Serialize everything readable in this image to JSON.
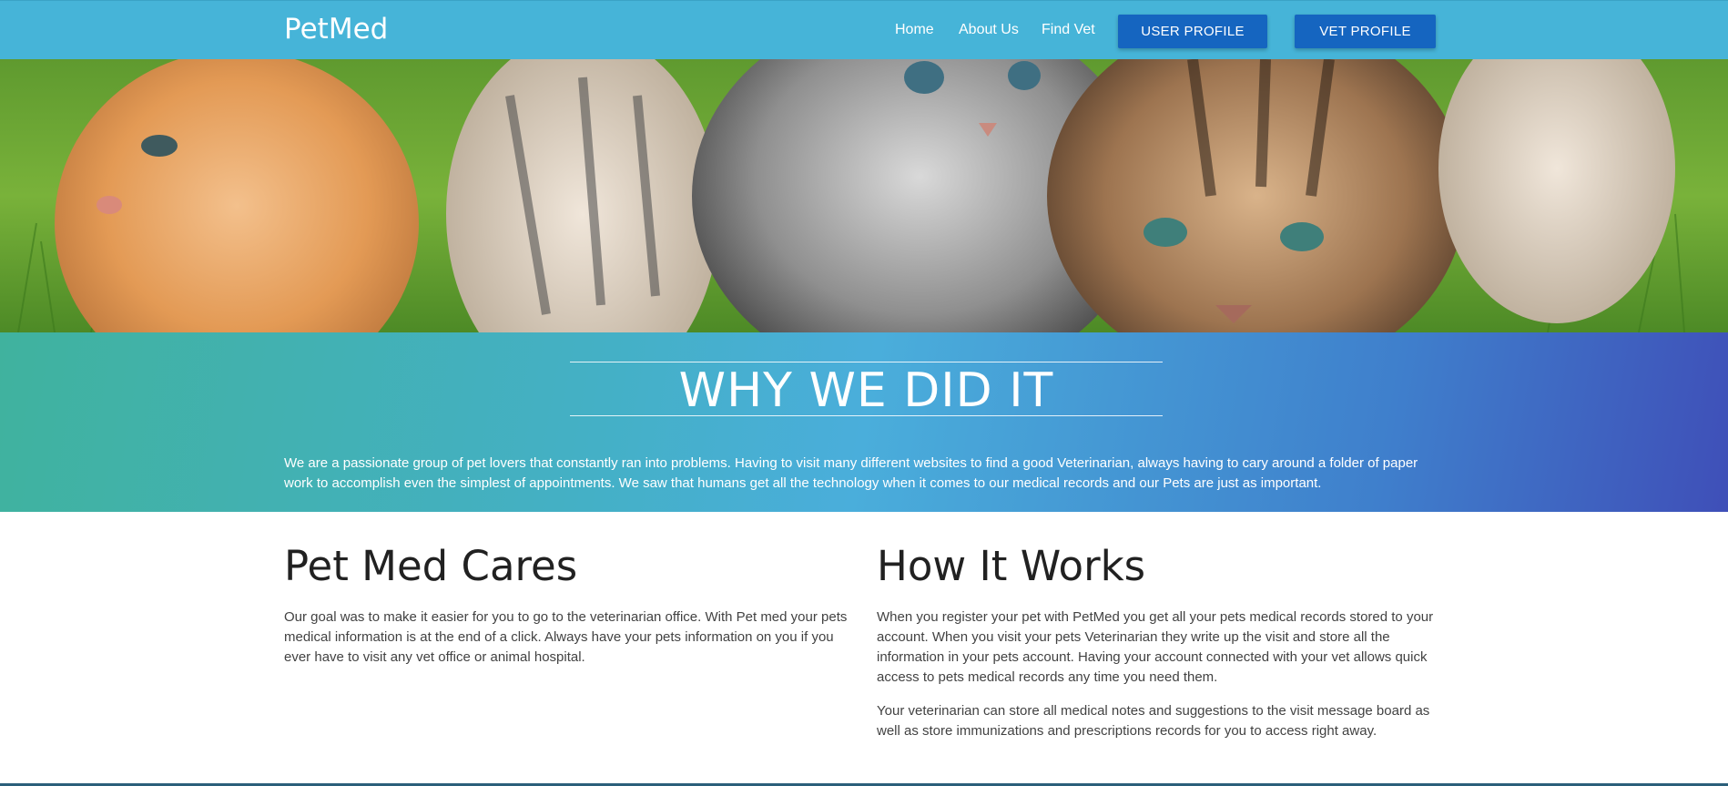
{
  "header": {
    "brand": "PetMed",
    "nav": [
      {
        "label": "Home"
      },
      {
        "label": "About Us"
      },
      {
        "label": "Find Vet"
      }
    ],
    "user_profile_label": "USER PROFILE",
    "vet_profile_label": "VET PROFILE"
  },
  "hero": {
    "image": "kittens-in-grass-photo"
  },
  "why": {
    "title": "WHY WE DID IT",
    "text": "We are a passionate group of pet lovers that constantly ran into problems. Having to visit many different websites to find a good Veterinarian, always having to cary around a folder of paper work to accomplish even the simplest of appointments. We saw that humans get all the technology when it comes to our medical records and our Pets are just as important."
  },
  "cares": {
    "title": "Pet Med Cares",
    "text": "Our goal was to make it easier for you to go to the veterinarian office. With Pet med your pets medical information is at the end of a click. Always have your pets information on you if you ever have to visit any vet office or animal hospital."
  },
  "how": {
    "title": "How It Works",
    "paragraphs": [
      "When you register your pet with PetMed you get all your pets medical records stored to your account. When you visit your pets Veterinarian they write up the visit and store all the information in your pets account. Having your account connected with your vet allows quick access to pets medical records any time you need them.",
      "Your veterinarian can store all medical notes and suggestions to the visit message board as well as store immunizations and prescriptions records for you to access right away."
    ]
  },
  "colors": {
    "navbar": "#46b4d8",
    "button": "#1565c0",
    "gradient_start": "#40b29e",
    "gradient_end": "#3f4fb8"
  }
}
